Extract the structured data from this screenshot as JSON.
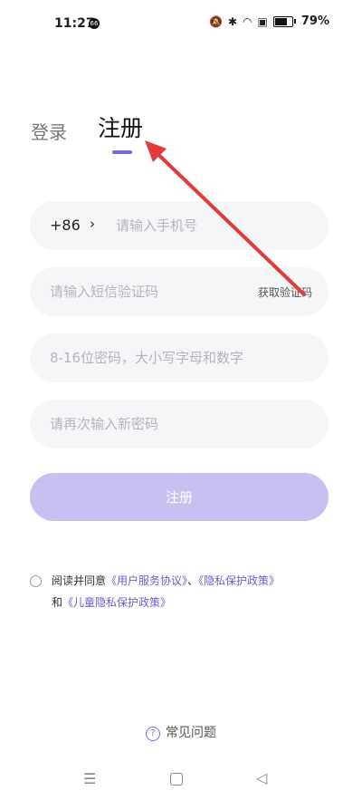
{
  "status_bar": {
    "time": "11:27",
    "notification_badge": "66",
    "battery_percent": "79%",
    "icons": [
      "mute-icon",
      "bluetooth-icon",
      "wifi-icon",
      "sim-icon",
      "battery-icon"
    ]
  },
  "tabs": {
    "login": "登录",
    "register": "注册",
    "active": "register"
  },
  "form": {
    "country_code": "+86",
    "phone_placeholder": "请输入手机号",
    "sms_placeholder": "请输入短信验证码",
    "get_code_label": "获取验证码",
    "password_placeholder": "8-16位密码，大小写字母和数字",
    "confirm_placeholder": "请再次输入新密码",
    "register_button": "注册"
  },
  "agreement": {
    "prefix": "阅读并同意",
    "user_agreement": "《用户服务协议》",
    "separator": "、",
    "privacy_policy": "《隐私保护政策》",
    "and": "和",
    "child_privacy_policy": "《儿童隐私保护政策》",
    "checked": false
  },
  "faq": {
    "label": "常见问题"
  },
  "colors": {
    "accent": "#7a6ad8",
    "button_disabled": "#c9c0f2",
    "field_bg": "#f5f6f8",
    "annotation": "#e23b3b"
  }
}
